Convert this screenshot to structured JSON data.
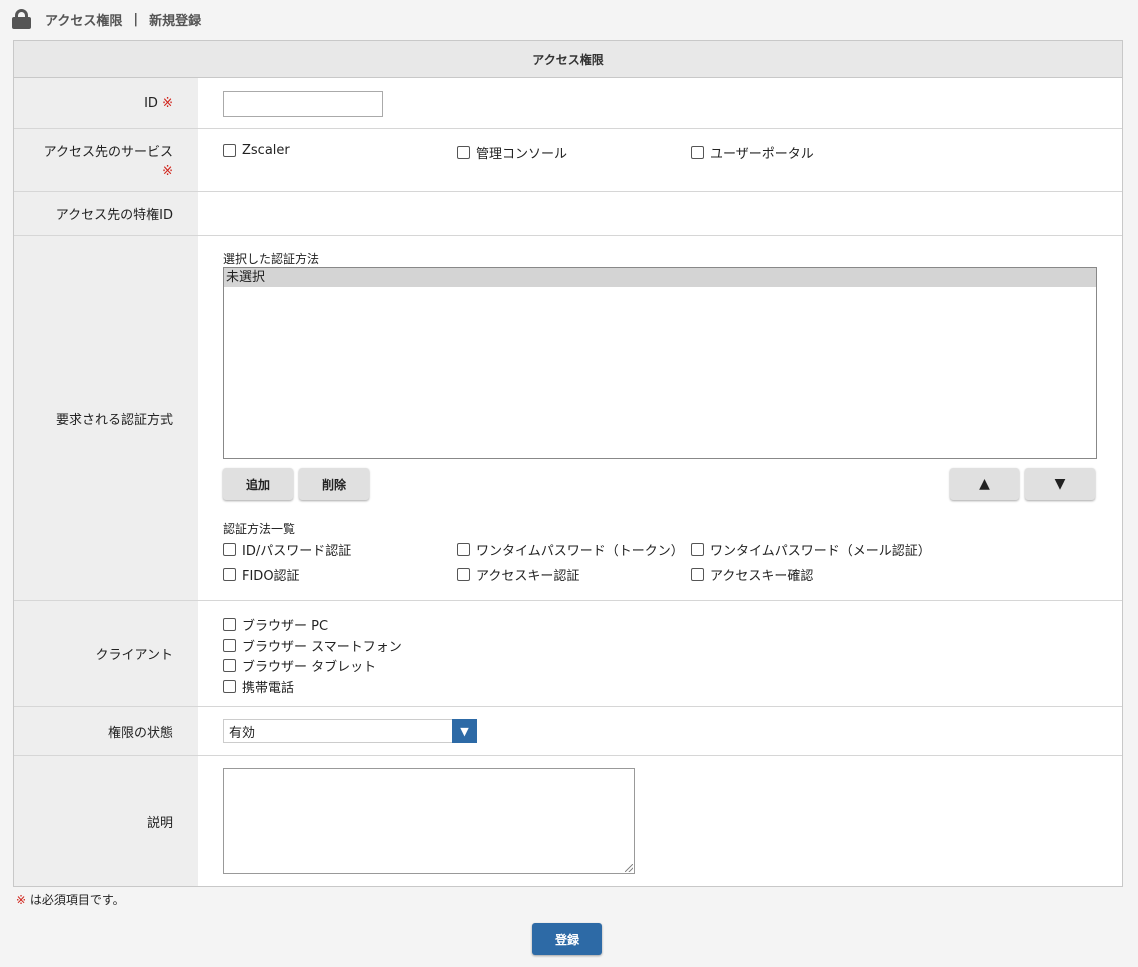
{
  "breadcrumb": {
    "icon": "lock-icon",
    "section": "アクセス権限",
    "separator": "|",
    "page": "新規登録"
  },
  "table": {
    "title": "アクセス権限"
  },
  "required_mark": "※",
  "id_field": {
    "label": "ID",
    "value": ""
  },
  "services": {
    "label": "アクセス先のサービス",
    "options": [
      "Zscaler",
      "管理コンソール",
      "ユーザーポータル"
    ]
  },
  "privilege_id": {
    "label": "アクセス先の特権ID"
  },
  "auth": {
    "label": "要求される認証方式",
    "selected_title": "選択した認証方法",
    "selected_items": [
      "未選択"
    ],
    "add_button": "追加",
    "delete_button": "削除",
    "up_button": "▲",
    "down_button": "▼",
    "list_title": "認証方法一覧",
    "methods": [
      "ID/パスワード認証",
      "ワンタイムパスワード（トークン）",
      "ワンタイムパスワード（メール認証）",
      "FIDO認証",
      "アクセスキー認証",
      "アクセスキー確認"
    ]
  },
  "client": {
    "label": "クライアント",
    "options": [
      "ブラウザー PC",
      "ブラウザー スマートフォン",
      "ブラウザー タブレット",
      "携帯電話"
    ]
  },
  "status": {
    "label": "権限の状態",
    "selected": "有効",
    "arrow": "▼"
  },
  "description": {
    "label": "説明",
    "value": ""
  },
  "footnote": {
    "mark": "※",
    "text": " は必須項目です。"
  },
  "submit_button": "登録",
  "colors": {
    "accent": "#2d6aa6",
    "required": "#d0241b"
  }
}
